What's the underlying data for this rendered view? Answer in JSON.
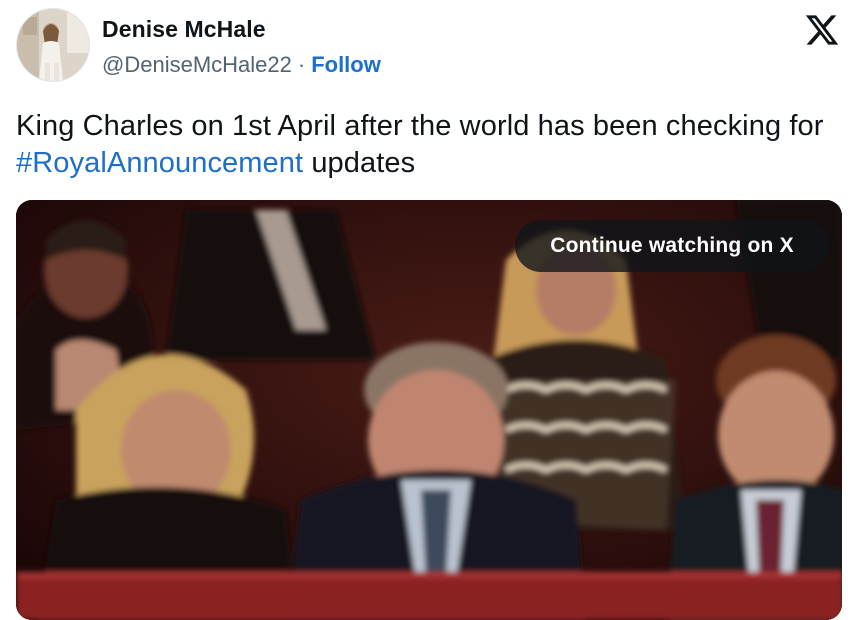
{
  "author": {
    "name": "Denise McHale",
    "handle": "@DeniseMcHale22",
    "separator": "·",
    "follow_label": "Follow"
  },
  "tweet": {
    "text_before": "King Charles on 1st April after the world has been checking for ",
    "hashtag": "#RoyalAnnouncement",
    "text_after": " updates"
  },
  "media": {
    "continue_label": "Continue watching on X"
  },
  "icons": {
    "brand": "x-logo-icon",
    "avatar": "profile-avatar"
  },
  "colors": {
    "link": "#1d6fc8",
    "text": "#0f1419",
    "secondary_text": "#536471",
    "overlay_button": "#0f1419"
  }
}
